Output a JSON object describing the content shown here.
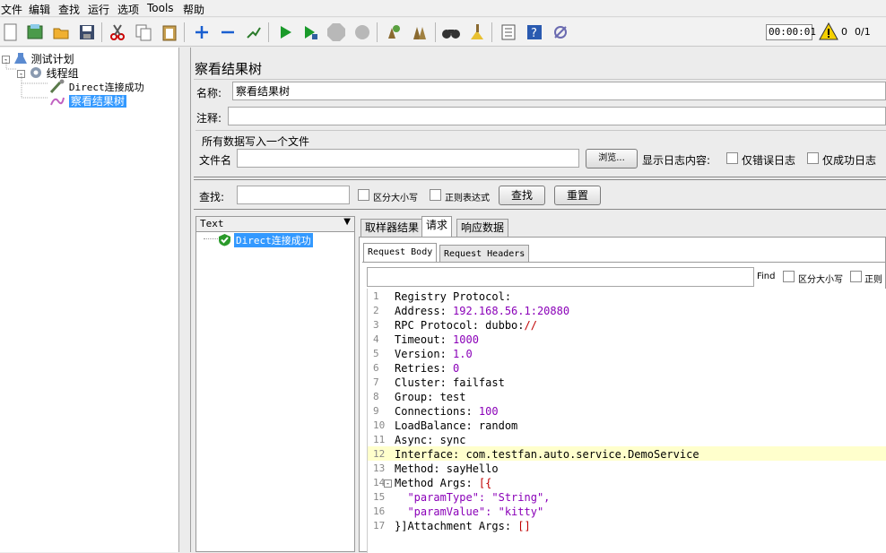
{
  "menu": [
    "文件",
    "编辑",
    "查找",
    "运行",
    "选项",
    "Tools",
    "帮助"
  ],
  "toolbar": {
    "timer": "00:00:01",
    "error_count": "0",
    "threads": "0/1"
  },
  "tree": {
    "root": "测试计划",
    "group": "线程组",
    "sampler": "Direct连接成功",
    "listener": "察看结果树"
  },
  "panel": {
    "title": "察看结果树",
    "name_label": "名称:",
    "name_value": "察看结果树",
    "comment_label": "注释:",
    "comment_value": "",
    "file_section": "所有数据写入一个文件",
    "file_label": "文件名",
    "file_value": "",
    "browse": "浏览...",
    "log_label": "显示日志内容:",
    "errors_only": "仅错误日志",
    "success_only": "仅成功日志",
    "search_label": "查找:",
    "search_value": "",
    "case_sensitive": "区分大小写",
    "regex": "正则表达式",
    "search_button": "查找",
    "reset_button": "重置"
  },
  "results": {
    "renderer": "Text",
    "item": "Direct连接成功",
    "tabs": [
      "取样器结果",
      "请求",
      "响应数据"
    ],
    "active_tab": "请求",
    "subtabs": [
      "Request Body",
      "Request Headers"
    ],
    "find_label": "Find",
    "find_case": "区分大小写",
    "find_regex": "正则"
  },
  "code_lines": [
    {
      "n": "1",
      "k": "Registry Protocol:",
      "v": ""
    },
    {
      "n": "2",
      "k": "Address: ",
      "v": "192.168.56.1:20880"
    },
    {
      "n": "3",
      "k": "RPC Protocol: dubbo:",
      "v": "//"
    },
    {
      "n": "4",
      "k": "Timeout: ",
      "v": "1000"
    },
    {
      "n": "5",
      "k": "Version: ",
      "v": "1.0"
    },
    {
      "n": "6",
      "k": "Retries: ",
      "v": "0"
    },
    {
      "n": "7",
      "k": "Cluster: failfast",
      "v": ""
    },
    {
      "n": "8",
      "k": "Group: test",
      "v": ""
    },
    {
      "n": "9",
      "k": "Connections: ",
      "v": "100"
    },
    {
      "n": "10",
      "k": "LoadBalance: random",
      "v": ""
    },
    {
      "n": "11",
      "k": "Async: sync",
      "v": ""
    },
    {
      "n": "12",
      "k": "Interface: com.testfan.auto.service.DemoService",
      "v": ""
    },
    {
      "n": "13",
      "k": "Method: sayHello",
      "v": ""
    },
    {
      "n": "14",
      "k": "Method Args: ",
      "v": "[{"
    },
    {
      "n": "15",
      "k": "  ",
      "v": "\"paramType\": \"String\","
    },
    {
      "n": "16",
      "k": "  ",
      "v": "\"paramValue\": \"kitty\""
    },
    {
      "n": "17",
      "k": "}]Attachment Args: ",
      "v": "[]"
    }
  ],
  "colors": {
    "highlight": "#ffffcc",
    "selection": "#3399ff",
    "accent": "#1a6fd0"
  }
}
